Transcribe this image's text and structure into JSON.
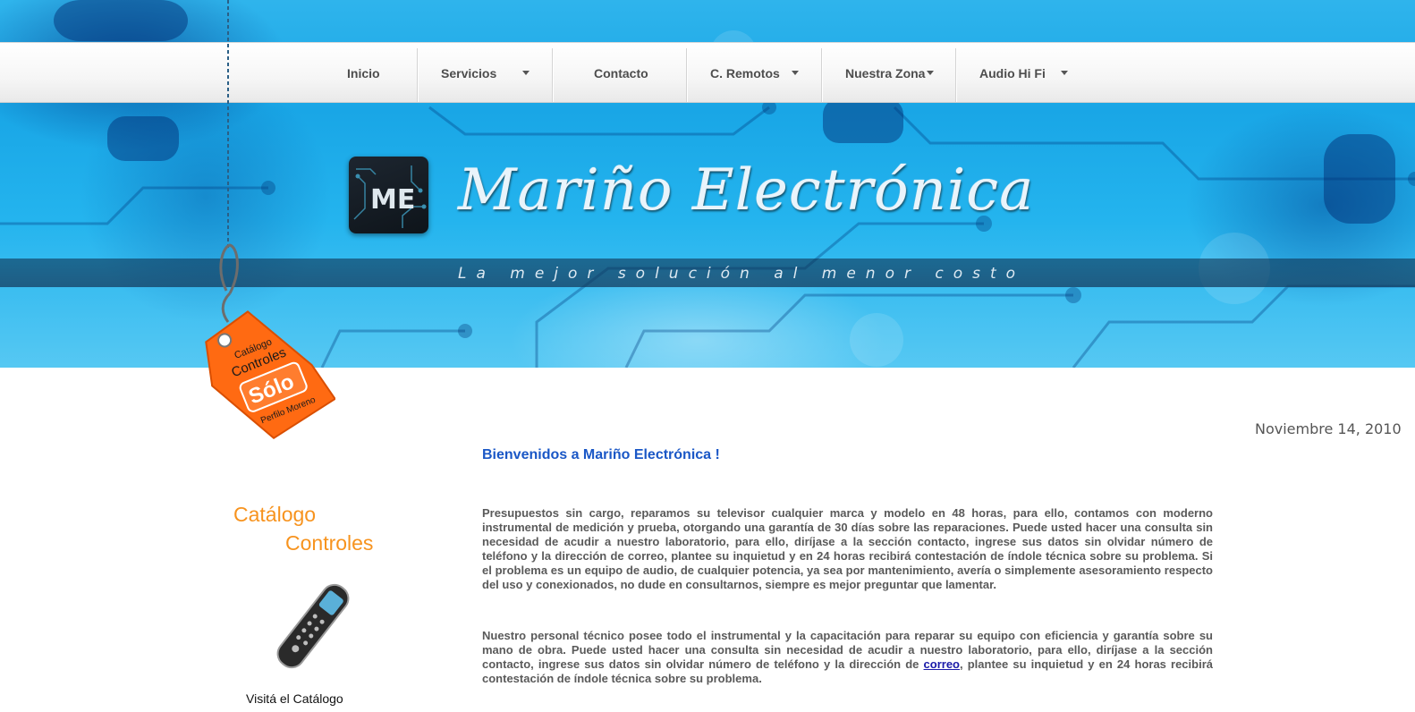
{
  "nav": {
    "items": [
      {
        "label": "Inicio",
        "dropdown": false
      },
      {
        "label": "Servicios",
        "dropdown": true
      },
      {
        "label": "Contacto",
        "dropdown": false
      },
      {
        "label": "C. Remotos",
        "dropdown": true
      },
      {
        "label": "Nuestra Zona",
        "dropdown": true
      },
      {
        "label": "Audio Hi Fi",
        "dropdown": true
      }
    ]
  },
  "header": {
    "logo_text": "Mariño Electrónica",
    "logo_mark": "ME",
    "tagline": "La mejor solución al menor costo"
  },
  "tag": {
    "line1": "Catálogo",
    "line2": "Controles",
    "line3": "Sólo",
    "line4": "Perfilo Moreno"
  },
  "sidebar": {
    "catalog_title_1": "Catálogo",
    "catalog_title_2": "Controles",
    "visit_label": "Visitá el Catálogo"
  },
  "main": {
    "date": "Noviembre 14, 2010",
    "welcome": "Bienvenidos a Mariño Electrónica !",
    "paragraph1": "Presupuestos sin cargo, reparamos su televisor cualquier marca y modelo en 48 horas, para ello, contamos con moderno instrumental de medición y prueba, otorgando una garantía de 30 días sobre las reparaciones. Puede usted hacer una consulta sin necesidad de acudir a nuestro laboratorio, para ello, diríjase a la sección contacto, ingrese sus datos sin olvidar número de teléfono y la dirección de correo, plantee su inquietud y en 24 horas recibirá contestación de índole técnica sobre su problema. Si el problema es un equipo de audio, de cualquier potencia, ya sea por mantenimiento, avería o simplemente asesoramiento respecto del uso y conexionados, no dude en consultarnos, siempre es mejor preguntar que lamentar.",
    "paragraph2_before": "Nuestro personal técnico posee todo el instrumental y la capacitación para reparar su equipo con eficiencia y garantía sobre su mano de obra. Puede usted hacer una consulta sin necesidad de acudir a nuestro laboratorio, para ello, diríjase a la sección contacto, ingrese sus datos sin olvidar número de teléfono y la dirección de ",
    "paragraph2_link": "correo",
    "paragraph2_after": ", plantee su inquietud y en 24 horas recibirá contestación de índole técnica sobre su problema."
  },
  "colors": {
    "accent_blue": "#1a57c6",
    "catalog_orange": "#f7931e",
    "banner_blue": "#1ea8e8"
  }
}
